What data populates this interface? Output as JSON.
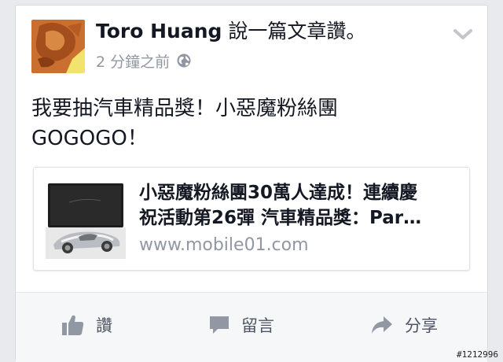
{
  "post": {
    "author_name": "Toro Huang",
    "action_text": "說一篇文章讚。",
    "timestamp": "2 分鐘之前",
    "privacy_icon": "globe-icon",
    "menu_icon": "chevron-down-icon",
    "status_lines": [
      "我要抽汽車精品獎！小惡魔粉絲團",
      "GOGOGO！"
    ]
  },
  "link_preview": {
    "title_lines": [
      "小惡魔粉絲團30萬人達成！連續慶",
      "祝活動第26彈 汽車精品獎：Par…"
    ],
    "domain": "www.mobile01.com"
  },
  "actions": {
    "like_label": "讚",
    "comment_label": "留言",
    "share_label": "分享"
  },
  "watermark": "#1212996",
  "colors": {
    "background": "#e9eaed",
    "text_primary": "#141823",
    "text_secondary": "#9197a3",
    "action_text": "#4e5665"
  }
}
